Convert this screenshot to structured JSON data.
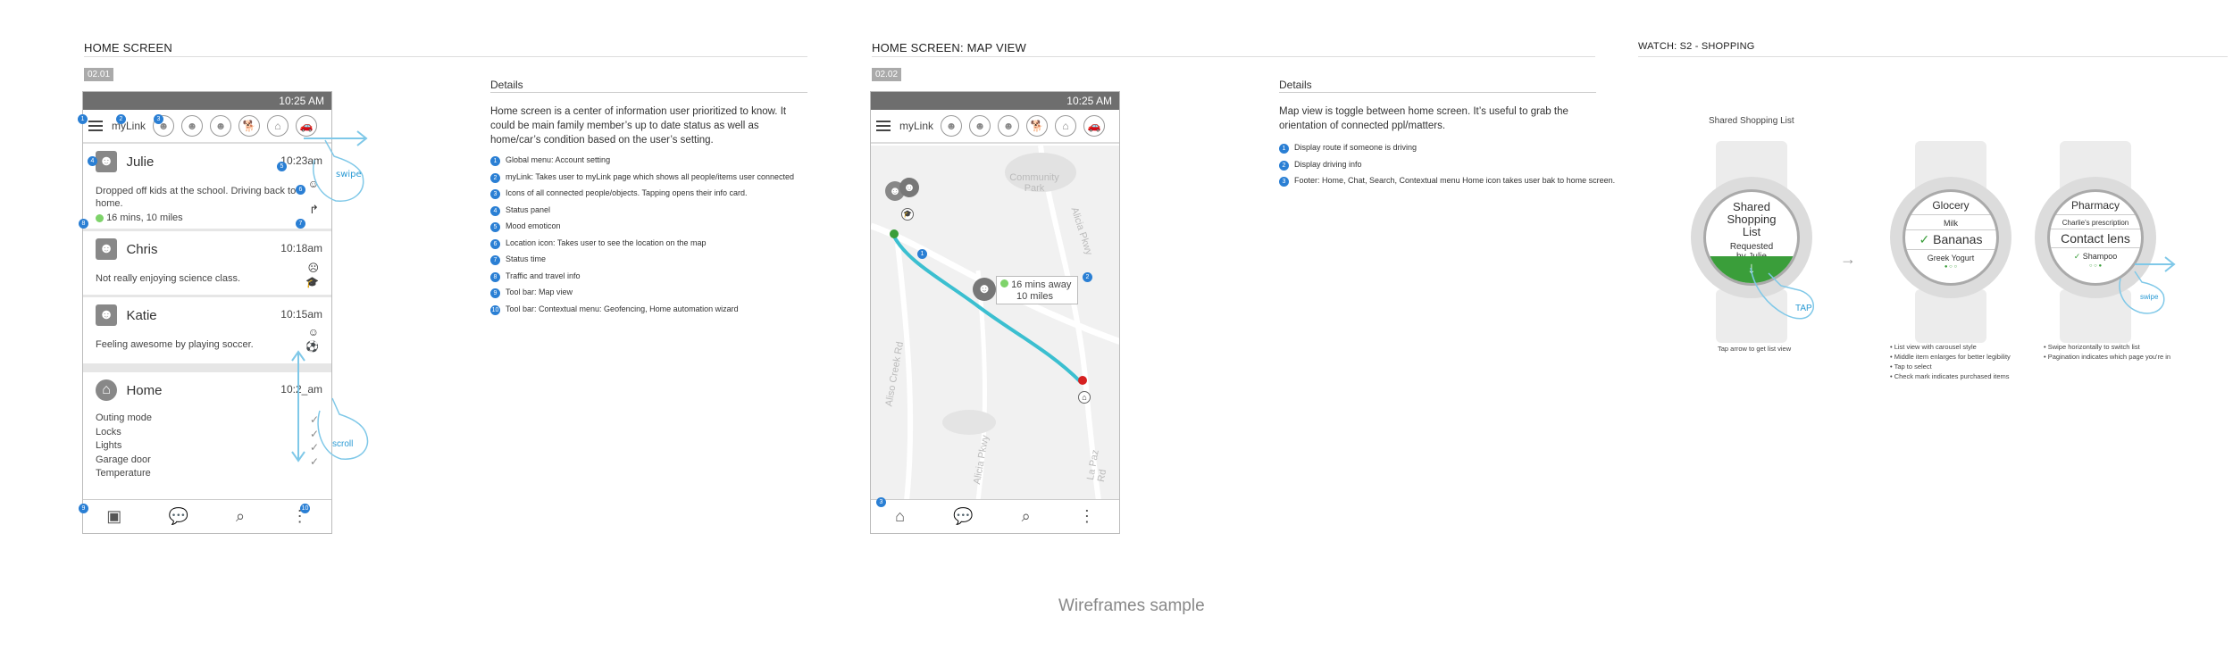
{
  "sections": {
    "home_title": "HOME SCREEN",
    "map_title": "HOME SCREEN: MAP VIEW",
    "watch_title": "WATCH: S2 - SHOPPING"
  },
  "home": {
    "tag": "02.01",
    "status_time": "10:25 AM",
    "brand": "myLink",
    "cards": [
      {
        "name": "Julie",
        "time": "10:23am",
        "msg": "Dropped off kids at the school. Driving back to home.",
        "extra": "16 mins, 10 miles"
      },
      {
        "name": "Chris",
        "time": "10:18am",
        "msg": "Not really enjoying science class."
      },
      {
        "name": "Katie",
        "time": "10:15am",
        "msg": "Feeling awesome by playing soccer."
      }
    ],
    "home_card": {
      "name": "Home",
      "time": "10:2_am",
      "items": [
        "Outing mode",
        "Locks",
        "Lights",
        "Garage door",
        "Temperature"
      ]
    },
    "gestures": {
      "swipe": "swipe",
      "scroll": "scroll"
    },
    "badges": [
      "1",
      "2",
      "3",
      "4",
      "5",
      "6",
      "7",
      "8",
      "9",
      "10"
    ]
  },
  "home_details": {
    "title": "Details",
    "text": "Home screen is a center of information user prioritized to know. It could be main family member’s up to date status as well as home/car’s condition based on the user’s setting.",
    "items": [
      "Global menu: Account setting",
      "myLink: Takes user to myLink page which shows all people/items user connected",
      "Icons of all connected people/objects. Tapping opens their info card.",
      "Status panel",
      "Mood emoticon",
      "Location icon: Takes user to see the location on the map",
      "Status time",
      "Traffic and travel info",
      "Tool bar: Map view",
      "Tool bar: Contextual menu: Geofencing, Home automation wizard"
    ]
  },
  "map": {
    "tag": "02.02",
    "status_time": "10:25 AM",
    "brand": "myLink",
    "map_labels": [
      "Community Park",
      "Alicia Pkwy",
      "Aliso Creek Rd",
      "La Paz Rd",
      "Aliso Creek Rd",
      "Alicia Pkwy"
    ],
    "eta": "16 mins away",
    "distance": "10 miles"
  },
  "map_details": {
    "title": "Details",
    "text": "Map view is toggle between home screen. It’s useful to grab the orientation of connected ppl/matters.",
    "items": [
      "Display route if someone is driving",
      "Display driving info",
      "Footer: Home, Chat, Search, Contextual menu Home icon takes user bak to home screen."
    ]
  },
  "watch": {
    "label": "Shared Shopping List",
    "w1": {
      "title": "Shared Shopping List",
      "sub": "Requested by Julie",
      "gesture": "TAP"
    },
    "w2": {
      "title": "Glocery",
      "top": "Milk",
      "mid": "Bananas",
      "bottom": "Greek Yogurt"
    },
    "w3": {
      "title": "Pharmacy",
      "top": "Charlie's prescription",
      "mid": "Contact lens",
      "bottom": "Shampoo",
      "gesture": "swipe"
    },
    "note1": "Tap arrow to get list view",
    "note2": [
      "List view with carousel style",
      "Middle item enlarges for better legibility",
      "Tap to select",
      "Check mark indicates purchased items"
    ],
    "note3": [
      "Swipe horizontally to switch list",
      "Pagination indicates which page you're in"
    ]
  },
  "caption": "Wireframes sample",
  "colors": {
    "accent": "#2a7fd4",
    "route": "#3bbfd0",
    "green": "#3a9e3a",
    "gesture": "#7fc8e8"
  }
}
